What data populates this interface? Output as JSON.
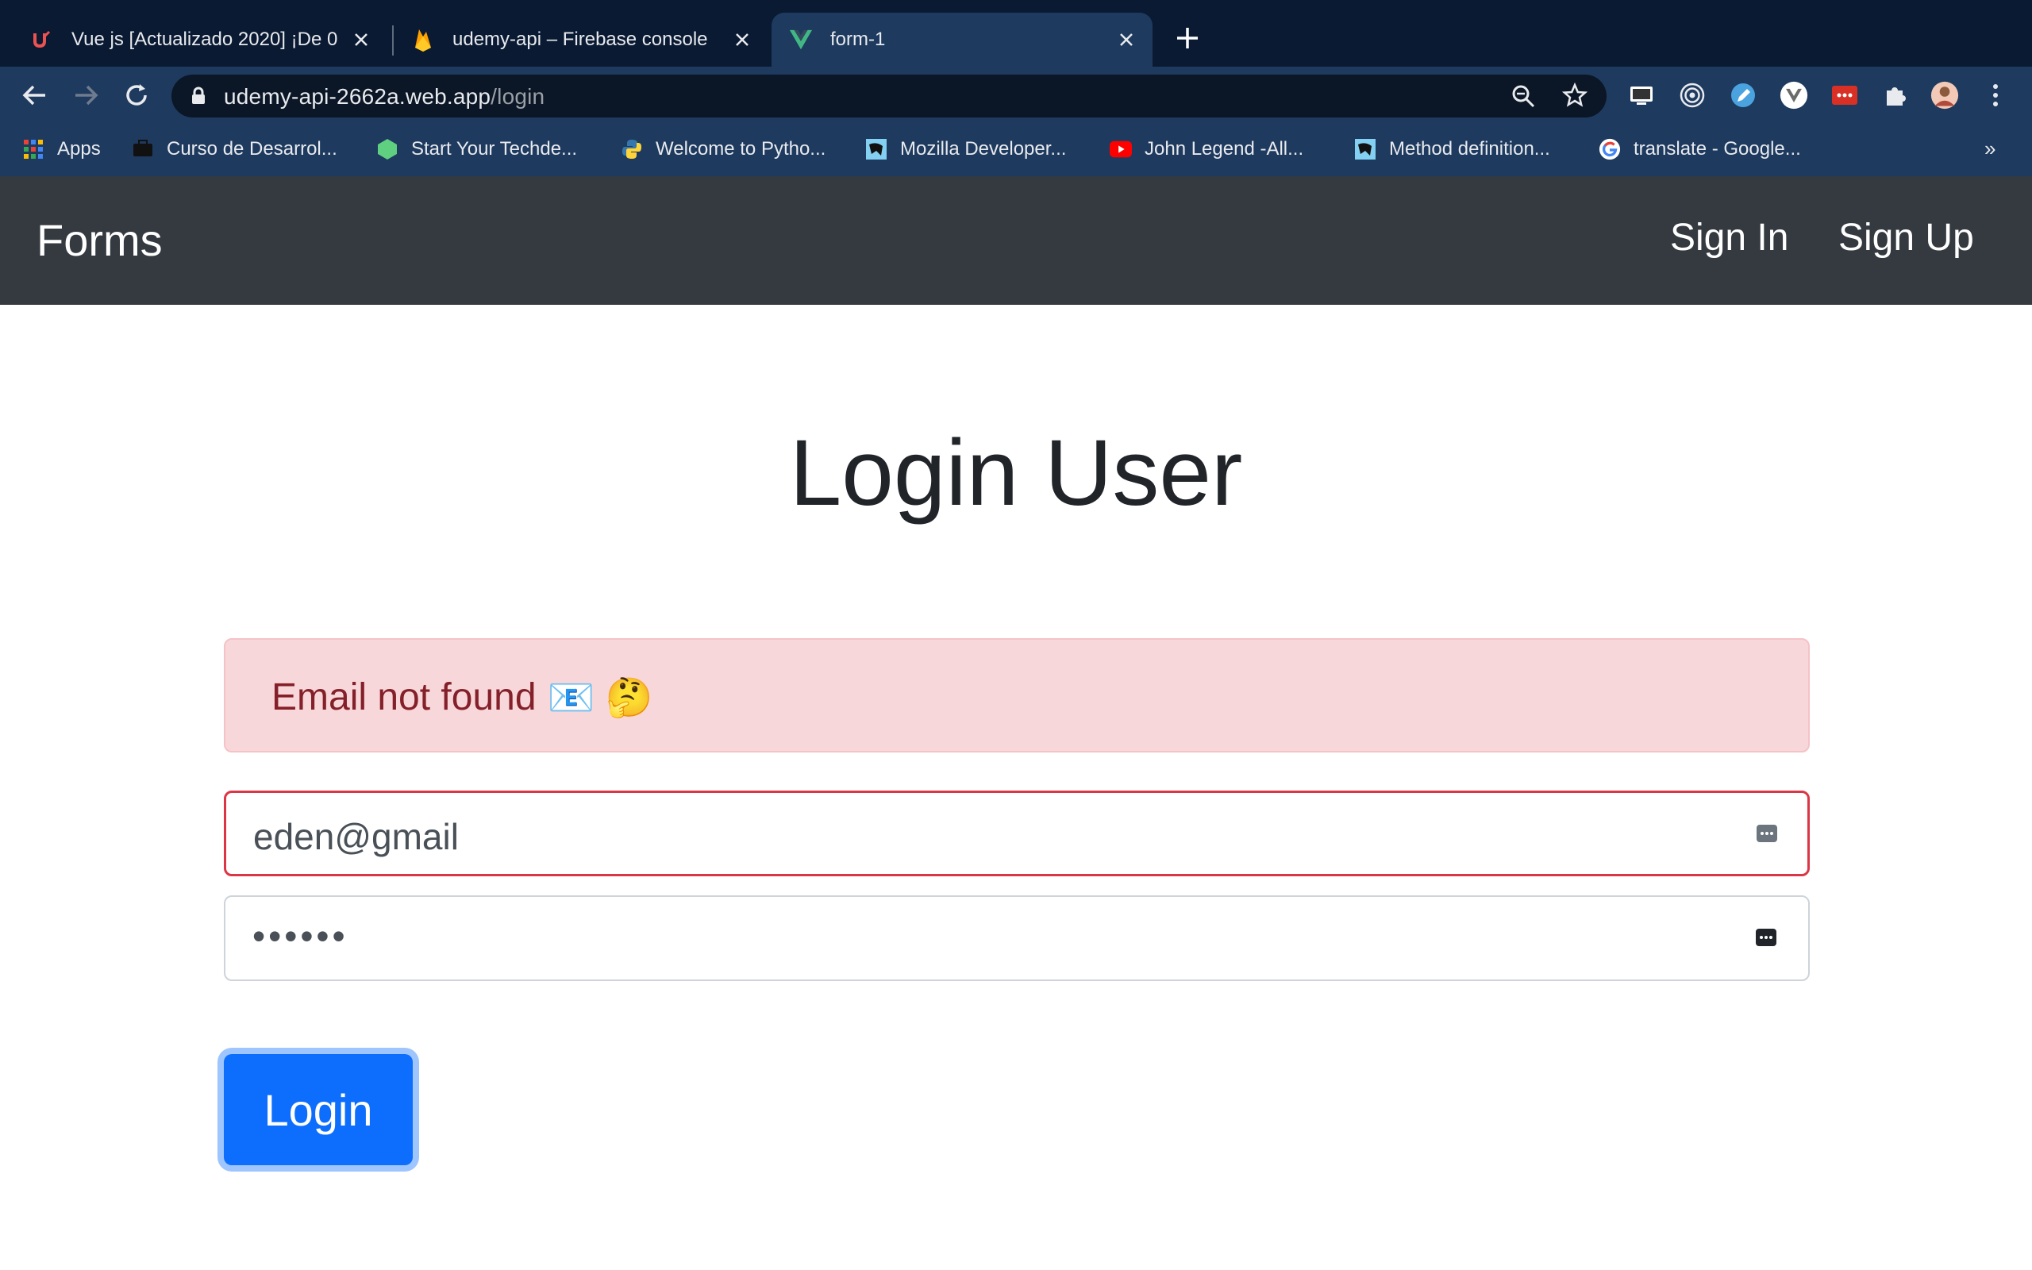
{
  "browser": {
    "tabs": [
      {
        "title": "Vue js [Actualizado 2020] ¡De 0",
        "active": false,
        "favicon": "udemy-icon"
      },
      {
        "title": "udemy-api – Firebase console",
        "active": false,
        "favicon": "firebase-icon"
      },
      {
        "title": "form-1",
        "active": true,
        "favicon": "vue-icon"
      }
    ],
    "address": {
      "host": "udemy-api-2662a.web.app",
      "path": "/login"
    },
    "bookmarks": [
      {
        "label": "Apps",
        "icon": "apps-grid-icon"
      },
      {
        "label": "Curso de Desarrol...",
        "icon": "bookmark-icon"
      },
      {
        "label": "Start Your Techde...",
        "icon": "bookmark-icon"
      },
      {
        "label": "Welcome to Pytho...",
        "icon": "python-icon"
      },
      {
        "label": "Mozilla Developer...",
        "icon": "mdn-icon"
      },
      {
        "label": "John Legend -All...",
        "icon": "youtube-icon"
      },
      {
        "label": "Method definition...",
        "icon": "mdn-icon"
      },
      {
        "label": "translate - Google...",
        "icon": "google-icon"
      }
    ],
    "more_bookmarks": "»"
  },
  "page": {
    "navbar": {
      "brand": "Forms",
      "links": [
        "Sign In",
        "Sign Up"
      ]
    },
    "heading": "Login User",
    "alert": {
      "message": "Email not found",
      "emoji": "📧 🤔"
    },
    "email_value": "eden@gmail",
    "password_mask": "••••••",
    "login_button": "Login"
  },
  "colors": {
    "navbar_bg": "#343a40",
    "alert_bg": "#f8d7da",
    "alert_text": "#842029",
    "invalid_border": "#dc3545",
    "primary": "#0d6efd"
  }
}
